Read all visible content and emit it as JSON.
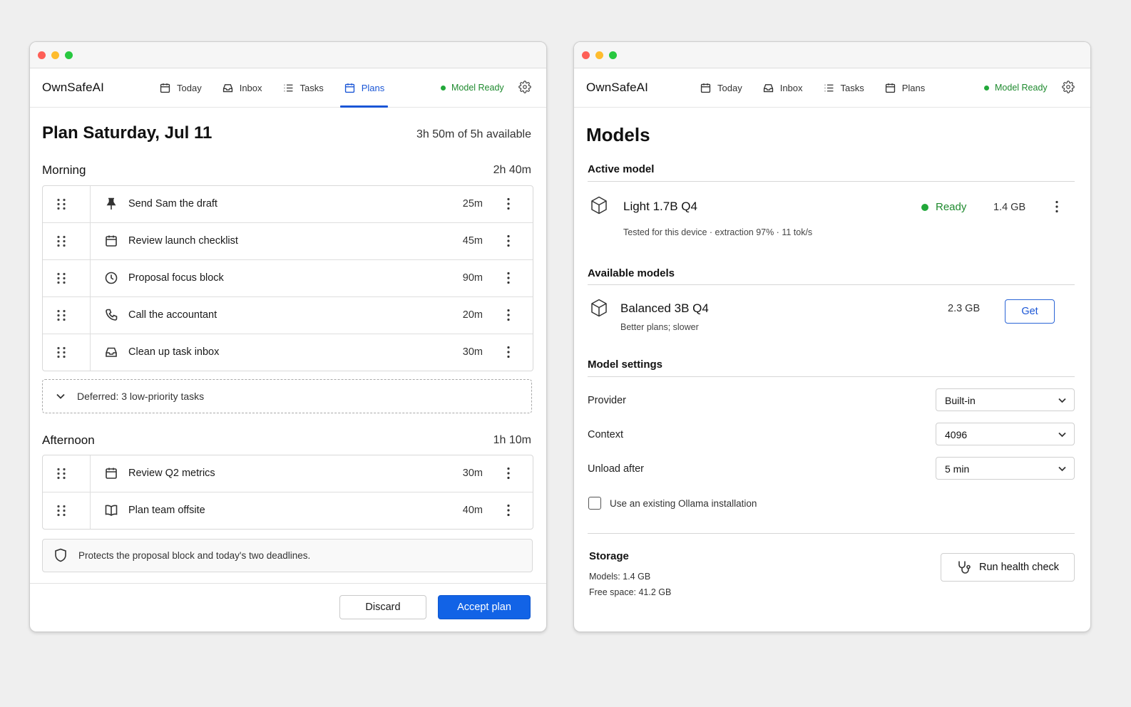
{
  "app": {
    "brand": "OwnSafeAI",
    "nav": {
      "today": "Today",
      "inbox": "Inbox",
      "tasks": "Tasks",
      "plans": "Plans"
    },
    "model_status": "Model Ready",
    "accent_color": "#1263e6",
    "ready_color": "#22a83a"
  },
  "plan": {
    "title": "Plan Saturday, Jul 11",
    "available": "3h 50m of 5h available",
    "morning": {
      "label": "Morning",
      "total": "2h 40m",
      "tasks": [
        {
          "title": "Send Sam the draft",
          "duration": "25m",
          "icon": "pin-icon"
        },
        {
          "title": "Review launch checklist",
          "duration": "45m",
          "icon": "calendar-icon"
        },
        {
          "title": "Proposal focus block",
          "duration": "90m",
          "icon": "clock-icon"
        },
        {
          "title": "Call the accountant",
          "duration": "20m",
          "icon": "phone-icon"
        },
        {
          "title": "Clean up task inbox",
          "duration": "30m",
          "icon": "inbox-icon"
        }
      ]
    },
    "deferred": "Deferred:  3 low-priority tasks",
    "afternoon": {
      "label": "Afternoon",
      "total": "1h 10m",
      "tasks": [
        {
          "title": "Review Q2 metrics",
          "duration": "30m",
          "icon": "calendar-icon"
        },
        {
          "title": "Plan team offsite",
          "duration": "40m",
          "icon": "book-icon"
        }
      ]
    },
    "note": "Protects the proposal block and today's two deadlines.",
    "discard_label": "Discard",
    "accept_label": "Accept plan"
  },
  "models": {
    "title": "Models",
    "active_section": "Active model",
    "active": {
      "name": "Light 1.7B Q4",
      "status": "Ready",
      "size": "1.4 GB",
      "detail": "Tested for this device  ·  extraction 97%  ·  11 tok/s"
    },
    "available_section": "Available models",
    "available": [
      {
        "name": "Balanced 3B Q4",
        "size": "2.3 GB",
        "subtitle": "Better plans; slower",
        "action": "Get"
      }
    ],
    "settings_section": "Model settings",
    "settings": {
      "provider": {
        "label": "Provider",
        "value": "Built-in"
      },
      "context": {
        "label": "Context",
        "value": "4096"
      },
      "unload": {
        "label": "Unload after",
        "value": "5 min"
      }
    },
    "ollama_checkbox": {
      "label": "Use an existing Ollama installation",
      "checked": false
    },
    "storage": {
      "title": "Storage",
      "models_line": "Models:  1.4 GB",
      "free_line": "Free space:  41.2 GB"
    },
    "health_check_label": "Run health check"
  }
}
